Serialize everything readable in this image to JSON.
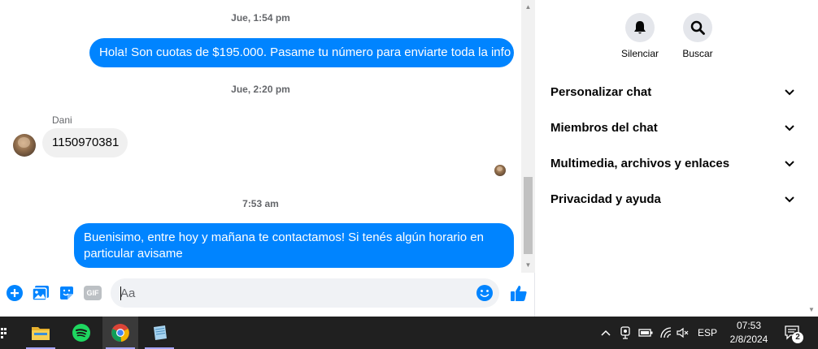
{
  "messages": {
    "ts1": "Jue, 1:54 pm",
    "out1": "Hola! Son cuotas de $195.000. Pasame tu número para enviarte toda la info",
    "ts2": "Jue, 2:20 pm",
    "sender_name": "Dani",
    "in1": "1150970381",
    "ts3": "7:53 am",
    "out2_line1": "Buenisimo, entre hoy y mañana te contactamos! Si tenés algún horario en",
    "out2_line2": "particular avisame"
  },
  "composer": {
    "placeholder": "Aa",
    "gif_label": "GIF"
  },
  "info_panel": {
    "actions": [
      {
        "label": "Silenciar",
        "icon": "bell-icon"
      },
      {
        "label": "Buscar",
        "icon": "search-icon"
      }
    ],
    "sections": [
      {
        "title": "Personalizar chat"
      },
      {
        "title": "Miembros del chat"
      },
      {
        "title": "Multimedia, archivos y enlaces"
      },
      {
        "title": "Privacidad y ayuda"
      }
    ]
  },
  "taskbar": {
    "apps": [
      "file-explorer-icon",
      "spotify-icon",
      "chrome-icon",
      "notepad-icon"
    ],
    "language": "ESP",
    "time": "07:53",
    "date": "2/8/2024",
    "notification_count": "2"
  },
  "colors": {
    "accent": "#0084ff",
    "incoming_bubble": "#f0f0f0",
    "taskbar": "#202020"
  }
}
